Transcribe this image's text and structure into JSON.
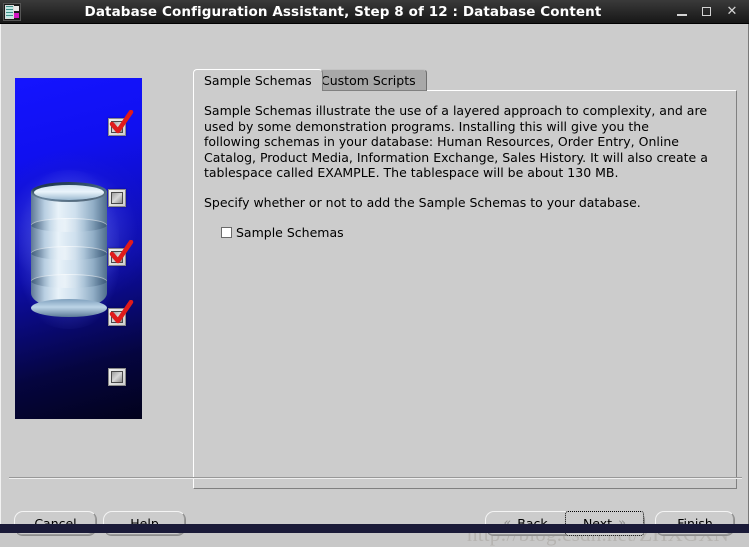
{
  "window": {
    "title": "Database Configuration Assistant, Step 8 of 12 : Database Content",
    "icon": "database-app-icon",
    "controls": {
      "minimize": "−",
      "maximize": "□",
      "close": "✕"
    }
  },
  "artwork": {
    "alt": "database-cylinder-illustration",
    "checkbox_icons": [
      {
        "name": "art-checkbox-1",
        "checked": true
      },
      {
        "name": "art-checkbox-2",
        "checked": false
      },
      {
        "name": "art-checkbox-3",
        "checked": true
      },
      {
        "name": "art-checkbox-4",
        "checked": true
      },
      {
        "name": "art-checkbox-5",
        "checked": false
      }
    ],
    "colors": {
      "blue_top": "#1414ff",
      "blue_bottom": "#02021c",
      "check_red": "#e01b1b"
    }
  },
  "tabs": [
    {
      "label": "Sample Schemas",
      "active": true
    },
    {
      "label": "Custom Scripts",
      "active": false
    }
  ],
  "content": {
    "paragraph1": "Sample Schemas illustrate the use of a layered approach to complexity, and are used by some demonstration programs. Installing this will give you the following schemas in your database: Human Resources, Order Entry, Online Catalog, Product Media, Information Exchange, Sales History. It will also create a tablespace called EXAMPLE. The tablespace will be about 130 MB.",
    "paragraph2": "Specify whether or not to add the Sample Schemas to your database.",
    "checkbox": {
      "label": "Sample Schemas",
      "checked": false
    }
  },
  "buttons": {
    "cancel": "Cancel",
    "help": "Help",
    "back": "Back",
    "next": "Next",
    "finish": "Finish",
    "back_arrow": "«",
    "next_arrow": "»",
    "focused": "next"
  },
  "watermark": {
    "text": "http://blog.csdn.net/ZHXGXN"
  },
  "colors": {
    "window_bg": "#cccccc",
    "titlebar_bg": "#2a2a2a",
    "titlebar_text": "#ffffff",
    "tab_inactive_bg": "#a8a8a8",
    "bottom_strip": "#1a1a38"
  }
}
